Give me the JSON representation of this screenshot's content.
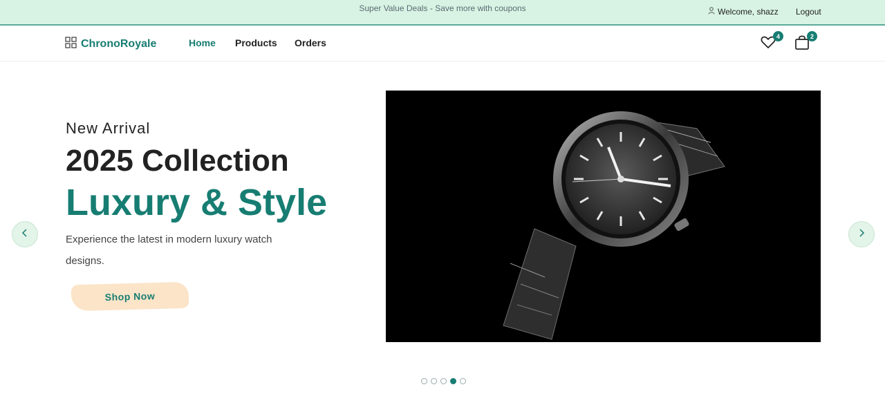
{
  "topbar": {
    "promo": "Super Value Deals - Save more with coupons",
    "welcome": "Welcome, shazz",
    "logout": "Logout"
  },
  "navbar": {
    "brand": "ChronoRoyale",
    "links": [
      "Home",
      "Products",
      "Orders"
    ],
    "wishlist_count": "4",
    "cart_count": "2"
  },
  "hero": {
    "kicker": "New Arrival",
    "title": "2025 Collection",
    "accent": "Luxury & Style",
    "description": "Experience the latest in modern luxury watch designs.",
    "cta": "Shop Now"
  },
  "carousel": {
    "slide_count": 5,
    "active_index": 3
  },
  "colors": {
    "accent": "#177d72",
    "topbar_bg": "#d8f3e3",
    "cta_bg": "#fbe4c8"
  },
  "icons": [
    "user-icon",
    "grid-logo-icon",
    "heart-icon",
    "bag-icon",
    "chevron-left-icon",
    "chevron-right-icon"
  ]
}
